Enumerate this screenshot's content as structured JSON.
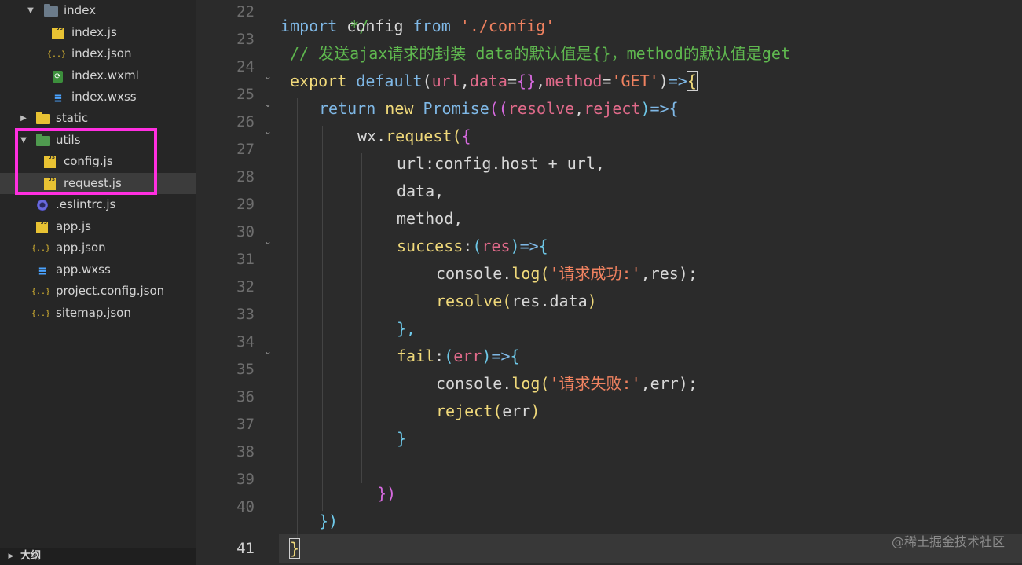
{
  "explorer": {
    "items": [
      {
        "name": "index",
        "type": "folder",
        "expanded": true
      },
      {
        "name": "index.js",
        "type": "js"
      },
      {
        "name": "index.json",
        "type": "json"
      },
      {
        "name": "index.wxml",
        "type": "wxml"
      },
      {
        "name": "index.wxss",
        "type": "wxss"
      },
      {
        "name": "static",
        "type": "folder",
        "expanded": false
      },
      {
        "name": "utils",
        "type": "folder",
        "expanded": true
      },
      {
        "name": "config.js",
        "type": "js"
      },
      {
        "name": "request.js",
        "type": "js",
        "selected": true
      },
      {
        "name": ".eslintrc.js",
        "type": "eslint"
      },
      {
        "name": "app.js",
        "type": "js"
      },
      {
        "name": "app.json",
        "type": "json"
      },
      {
        "name": "app.wxss",
        "type": "wxss"
      },
      {
        "name": "project.config.json",
        "type": "json"
      },
      {
        "name": "sitemap.json",
        "type": "json"
      }
    ],
    "outline_label": "大纲",
    "highlight_color": "#ff2fe0"
  },
  "editor": {
    "line_numbers": [
      "22",
      "23",
      "24",
      "25",
      "26",
      "27",
      "28",
      "29",
      "30",
      "31",
      "32",
      "33",
      "34",
      "35",
      "36",
      "37",
      "38",
      "39",
      "40",
      "41"
    ],
    "current_line": "41",
    "top_partial": "*/",
    "code": {
      "l22": {
        "kw1": "import",
        "name": "config",
        "kw2": "from",
        "str": "'./config'"
      },
      "l23": {
        "comment": "// 发送ajax请求的封装 data的默认值是{}，method的默认值是get"
      },
      "l24": {
        "kw1": "export",
        "kw2": "default",
        "p1": "(",
        "a1": "url",
        "c1": ",",
        "a2": "data",
        "eq1": "=",
        "obj": "{}",
        "c2": ",",
        "a3": "method",
        "eq2": "=",
        "str": "'GET'",
        "p2": ")",
        "arrow": "=>",
        "brace": "{"
      },
      "l25": {
        "kw": "return",
        "kw2": "new",
        "cls": "Promise",
        "p1": "((",
        "a1": "resolve",
        "c": ",",
        "a2": "reject",
        "p2": ")",
        "arrow": "=>",
        "brace": "{"
      },
      "l26": {
        "obj": "wx",
        "dot": ".",
        "fn": "request",
        "p": "(",
        "brace": "{"
      },
      "l27": {
        "key": "url",
        "rest": ":config.host + url,"
      },
      "l28": {
        "text": "data,"
      },
      "l29": {
        "text": "method,"
      },
      "l30": {
        "key": "success",
        "colon": ":",
        "p1": "(",
        "arg": "res",
        "p2": ")",
        "arrow": "=>",
        "brace": "{"
      },
      "l31": {
        "obj": "console",
        "dot": ".",
        "fn": "log",
        "p1": "(",
        "str": "'请求成功:'",
        "rest": ",res);"
      },
      "l32": {
        "fn": "resolve",
        "p1": "(",
        "rest": "res.data",
        "p2": ")"
      },
      "l33": {
        "text": "},"
      },
      "l34": {
        "key": "fail",
        "colon": ":",
        "p1": "(",
        "arg": "err",
        "p2": ")",
        "arrow": "=>",
        "brace": "{"
      },
      "l35": {
        "obj": "console",
        "dot": ".",
        "fn": "log",
        "p1": "(",
        "str": "'请求失败:'",
        "rest": ",err);"
      },
      "l36": {
        "fn": "reject",
        "p1": "(",
        "rest": "err",
        "p2": ")"
      },
      "l37": {
        "text": "}"
      },
      "l39": {
        "text": "})"
      },
      "l40": {
        "text": "})"
      },
      "l41": {
        "text": "}"
      }
    }
  },
  "watermark": "@稀土掘金技术社区"
}
